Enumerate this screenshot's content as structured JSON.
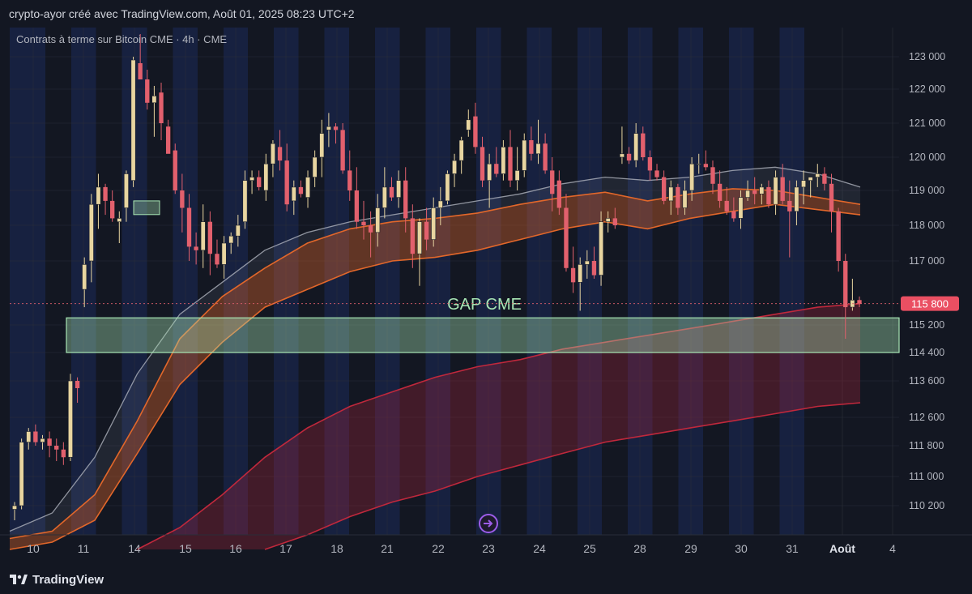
{
  "header": {
    "attribution": "crypto-ayor créé avec TradingView.com, Août 01, 2025 08:23 UTC+2"
  },
  "legend": {
    "symbol": "Contrats à terme sur Bitcoin CME · 4h · CME"
  },
  "footer": {
    "brand": "TradingView"
  },
  "colors": {
    "background": "#131722",
    "stripe": "#172140",
    "bull": "#e8d5a0",
    "bear": "#e2606d",
    "gap": "#a8e6b4",
    "band_orange": "#e2672a",
    "band_red": "#c0283c",
    "band_white": "#b2b5be"
  },
  "chart_data": {
    "type": "candlestick",
    "timeframe": "4h",
    "x_labels": [
      "10",
      "11",
      "14",
      "15",
      "16",
      "17",
      "18",
      "21",
      "22",
      "23",
      "24",
      "25",
      "28",
      "29",
      "30",
      "31",
      "Août",
      "4"
    ],
    "y_ticks": [
      123000,
      122000,
      121000,
      120000,
      119000,
      118000,
      117000,
      115200,
      114400,
      113600,
      112600,
      111800,
      111000,
      110200
    ],
    "y_ticks_visible": [
      "123 000",
      "122 000",
      "121 000",
      "120 000",
      "119 000",
      "118 000",
      "117 000",
      "115 200",
      "114 400",
      "113 600",
      "112 600",
      "111 800",
      "111 000",
      "110 200"
    ],
    "last_price": 115800,
    "last_price_label": "115 800",
    "candles": [
      [
        110100,
        110300,
        109800,
        110200
      ],
      [
        110200,
        112000,
        110100,
        111900
      ],
      [
        111900,
        112300,
        111700,
        112200
      ],
      [
        112200,
        112400,
        111800,
        111900
      ],
      [
        111900,
        112100,
        111700,
        112000
      ],
      [
        112000,
        112200,
        111500,
        111800
      ],
      [
        111800,
        112000,
        111400,
        111700
      ],
      [
        111700,
        111900,
        111300,
        111500
      ],
      [
        111500,
        113800,
        111400,
        113600
      ],
      [
        113600,
        113700,
        113000,
        113400
      ],
      [
        116200,
        117100,
        115700,
        116900
      ],
      [
        117000,
        118900,
        116400,
        118600
      ],
      [
        118600,
        119500,
        117900,
        119100
      ],
      [
        119100,
        119200,
        118300,
        118700
      ],
      [
        118700,
        119000,
        118100,
        118200
      ],
      [
        118100,
        118400,
        117500,
        118200
      ],
      [
        118500,
        119600,
        118100,
        119500
      ],
      [
        119300,
        123000,
        119100,
        122900
      ],
      [
        122800,
        123700,
        122400,
        122300
      ],
      [
        122300,
        122600,
        121400,
        121600
      ],
      [
        121600,
        122100,
        120600,
        121800
      ],
      [
        121900,
        122200,
        120500,
        121000
      ],
      [
        120900,
        121100,
        120300,
        120100
      ],
      [
        120200,
        120400,
        118900,
        119000
      ],
      [
        119000,
        119500,
        117800,
        118500
      ],
      [
        118500,
        118900,
        117000,
        117400
      ],
      [
        117400,
        117800,
        116900,
        117300
      ],
      [
        117300,
        118600,
        116800,
        118100
      ],
      [
        118100,
        118400,
        116600,
        117200
      ],
      [
        117200,
        117600,
        116800,
        116900
      ],
      [
        116900,
        117700,
        116500,
        117500
      ],
      [
        117500,
        117800,
        117200,
        117700
      ],
      [
        117700,
        118300,
        117400,
        118000
      ],
      [
        118100,
        119600,
        117900,
        119300
      ],
      [
        119300,
        119600,
        118900,
        119400
      ],
      [
        119400,
        119600,
        119000,
        119100
      ],
      [
        119000,
        120100,
        118700,
        119800
      ],
      [
        119800,
        120500,
        119400,
        120400
      ],
      [
        120300,
        120800,
        119600,
        119900
      ],
      [
        119900,
        120400,
        118400,
        118600
      ],
      [
        118700,
        119300,
        118300,
        119100
      ],
      [
        119100,
        119300,
        118800,
        118900
      ],
      [
        118800,
        119600,
        118500,
        119400
      ],
      [
        119400,
        120200,
        119100,
        120000
      ],
      [
        120000,
        121100,
        119400,
        120700
      ],
      [
        120800,
        121300,
        120300,
        120900
      ],
      [
        120900,
        121000,
        120400,
        120800
      ],
      [
        120800,
        121000,
        119500,
        119600
      ],
      [
        119600,
        120200,
        118700,
        119000
      ],
      [
        119000,
        119700,
        117900,
        118100
      ],
      [
        118100,
        118700,
        117600,
        118000
      ],
      [
        118000,
        118400,
        117100,
        117800
      ],
      [
        117800,
        118900,
        117400,
        118500
      ],
      [
        118500,
        119700,
        118200,
        119100
      ],
      [
        119100,
        119400,
        118700,
        118800
      ],
      [
        118800,
        119600,
        118500,
        119300
      ],
      [
        119300,
        119700,
        117800,
        118200
      ],
      [
        118200,
        118600,
        116800,
        117200
      ],
      [
        117200,
        118200,
        116300,
        118100
      ],
      [
        118100,
        118500,
        117300,
        117600
      ],
      [
        117600,
        118800,
        117400,
        118500
      ],
      [
        118500,
        119100,
        118000,
        118700
      ],
      [
        118700,
        119600,
        118600,
        119500
      ],
      [
        119500,
        120100,
        119100,
        119900
      ],
      [
        119900,
        120600,
        119500,
        120500
      ],
      [
        120800,
        121400,
        120600,
        121100
      ],
      [
        121200,
        121600,
        120100,
        120300
      ],
      [
        120300,
        120600,
        119100,
        119300
      ],
      [
        119300,
        120100,
        118500,
        119800
      ],
      [
        119800,
        120300,
        119400,
        119500
      ],
      [
        119500,
        120500,
        119300,
        120300
      ],
      [
        120300,
        120800,
        119100,
        119300
      ],
      [
        119300,
        120300,
        119000,
        119600
      ],
      [
        119600,
        120700,
        119400,
        120500
      ],
      [
        120500,
        120900,
        119900,
        120100
      ],
      [
        120100,
        121100,
        119800,
        120400
      ],
      [
        120400,
        120700,
        119500,
        119600
      ],
      [
        119600,
        120000,
        118400,
        118900
      ],
      [
        119300,
        119600,
        118300,
        118500
      ],
      [
        118500,
        118900,
        116700,
        116800
      ],
      [
        116800,
        117400,
        116100,
        116400
      ],
      [
        116400,
        117100,
        115600,
        116900
      ],
      [
        116900,
        117300,
        116500,
        117000
      ],
      [
        117000,
        117400,
        116500,
        116600
      ],
      [
        116600,
        118400,
        116300,
        118100
      ],
      [
        118100,
        118400,
        117800,
        118200
      ],
      [
        118200,
        118500,
        117900,
        118000
      ],
      [
        120000,
        120900,
        119800,
        120100
      ],
      [
        120100,
        120300,
        119800,
        119900
      ],
      [
        119900,
        121000,
        119700,
        120700
      ],
      [
        120700,
        120900,
        119900,
        120000
      ],
      [
        120000,
        120200,
        119300,
        119600
      ],
      [
        119600,
        119800,
        119300,
        119400
      ],
      [
        119400,
        119600,
        118600,
        118700
      ],
      [
        118700,
        119300,
        118300,
        119100
      ],
      [
        119100,
        119200,
        118300,
        118500
      ],
      [
        118500,
        119300,
        118300,
        119000
      ],
      [
        119000,
        120000,
        118700,
        119800
      ],
      [
        119800,
        120100,
        119500,
        119800
      ],
      [
        119800,
        120200,
        119600,
        119700
      ],
      [
        119700,
        119900,
        118900,
        119200
      ],
      [
        119200,
        119600,
        118500,
        118700
      ],
      [
        118700,
        119100,
        118300,
        118400
      ],
      [
        118400,
        118800,
        118100,
        118200
      ],
      [
        118200,
        119000,
        117900,
        118800
      ],
      [
        118800,
        119300,
        118700,
        119000
      ],
      [
        119000,
        119400,
        118600,
        118900
      ],
      [
        118900,
        119200,
        118600,
        119100
      ],
      [
        119100,
        119300,
        118500,
        118600
      ],
      [
        118600,
        119600,
        118300,
        119400
      ],
      [
        119400,
        119800,
        118600,
        118700
      ],
      [
        118700,
        119300,
        117100,
        118400
      ],
      [
        118400,
        119300,
        118000,
        119100
      ],
      [
        119100,
        119600,
        118600,
        119300
      ],
      [
        119300,
        119400,
        118800,
        119400
      ],
      [
        119400,
        119800,
        119100,
        119500
      ],
      [
        119500,
        119700,
        119000,
        119200
      ],
      [
        119200,
        119500,
        117800,
        118400
      ],
      [
        118400,
        118500,
        116700,
        117000
      ],
      [
        117000,
        117200,
        114800,
        115700
      ],
      [
        115700,
        116500,
        115600,
        115900
      ],
      [
        115900,
        116000,
        115700,
        115800
      ]
    ],
    "bands": {
      "orange_upper": [
        [
          0,
          109300
        ],
        [
          0.05,
          109500
        ],
        [
          0.1,
          110500
        ],
        [
          0.15,
          112500
        ],
        [
          0.2,
          114800
        ],
        [
          0.25,
          116000
        ],
        [
          0.3,
          116800
        ],
        [
          0.35,
          117500
        ],
        [
          0.4,
          117900
        ],
        [
          0.45,
          118100
        ],
        [
          0.5,
          118200
        ],
        [
          0.55,
          118350
        ],
        [
          0.6,
          118600
        ],
        [
          0.65,
          118800
        ],
        [
          0.7,
          118950
        ],
        [
          0.75,
          118700
        ],
        [
          0.8,
          118900
        ],
        [
          0.85,
          119050
        ],
        [
          0.9,
          119000
        ],
        [
          0.95,
          118800
        ],
        [
          1,
          118600
        ]
      ],
      "orange_lower": [
        [
          0,
          109000
        ],
        [
          0.05,
          109200
        ],
        [
          0.1,
          109800
        ],
        [
          0.15,
          111600
        ],
        [
          0.2,
          113500
        ],
        [
          0.25,
          114700
        ],
        [
          0.3,
          115700
        ],
        [
          0.35,
          116200
        ],
        [
          0.4,
          116700
        ],
        [
          0.45,
          117000
        ],
        [
          0.5,
          117100
        ],
        [
          0.55,
          117300
        ],
        [
          0.6,
          117600
        ],
        [
          0.65,
          117900
        ],
        [
          0.7,
          118100
        ],
        [
          0.75,
          117900
        ],
        [
          0.8,
          118200
        ],
        [
          0.85,
          118400
        ],
        [
          0.9,
          118600
        ],
        [
          0.95,
          118450
        ],
        [
          1,
          118300
        ]
      ],
      "white_band": [
        [
          0,
          109500
        ],
        [
          0.05,
          110000
        ],
        [
          0.1,
          111500
        ],
        [
          0.15,
          113800
        ],
        [
          0.2,
          115500
        ],
        [
          0.25,
          116400
        ],
        [
          0.3,
          117300
        ],
        [
          0.35,
          117800
        ],
        [
          0.4,
          118100
        ],
        [
          0.45,
          118300
        ],
        [
          0.5,
          118500
        ],
        [
          0.55,
          118700
        ],
        [
          0.6,
          118900
        ],
        [
          0.65,
          119200
        ],
        [
          0.7,
          119400
        ],
        [
          0.75,
          119300
        ],
        [
          0.8,
          119400
        ],
        [
          0.85,
          119600
        ],
        [
          0.9,
          119700
        ],
        [
          0.95,
          119500
        ],
        [
          1,
          119100
        ]
      ],
      "red_upper": [
        [
          0.15,
          109000
        ],
        [
          0.2,
          109600
        ],
        [
          0.25,
          110500
        ],
        [
          0.3,
          111500
        ],
        [
          0.35,
          112300
        ],
        [
          0.4,
          112900
        ],
        [
          0.45,
          113300
        ],
        [
          0.5,
          113700
        ],
        [
          0.55,
          114000
        ],
        [
          0.6,
          114200
        ],
        [
          0.65,
          114500
        ],
        [
          0.7,
          114700
        ],
        [
          0.75,
          114900
        ],
        [
          0.8,
          115100
        ],
        [
          0.85,
          115300
        ],
        [
          0.9,
          115500
        ],
        [
          0.95,
          115700
        ],
        [
          1,
          115800
        ]
      ],
      "red_lower": [
        [
          0.3,
          109000
        ],
        [
          0.35,
          109400
        ],
        [
          0.4,
          109900
        ],
        [
          0.45,
          110300
        ],
        [
          0.5,
          110600
        ],
        [
          0.55,
          111000
        ],
        [
          0.6,
          111300
        ],
        [
          0.65,
          111600
        ],
        [
          0.7,
          111900
        ],
        [
          0.75,
          112100
        ],
        [
          0.8,
          112300
        ],
        [
          0.85,
          112500
        ],
        [
          0.9,
          112700
        ],
        [
          0.95,
          112900
        ],
        [
          1,
          113000
        ]
      ]
    },
    "gap_zone": {
      "label": "GAP CME",
      "from": 114400,
      "to": 115400
    }
  }
}
